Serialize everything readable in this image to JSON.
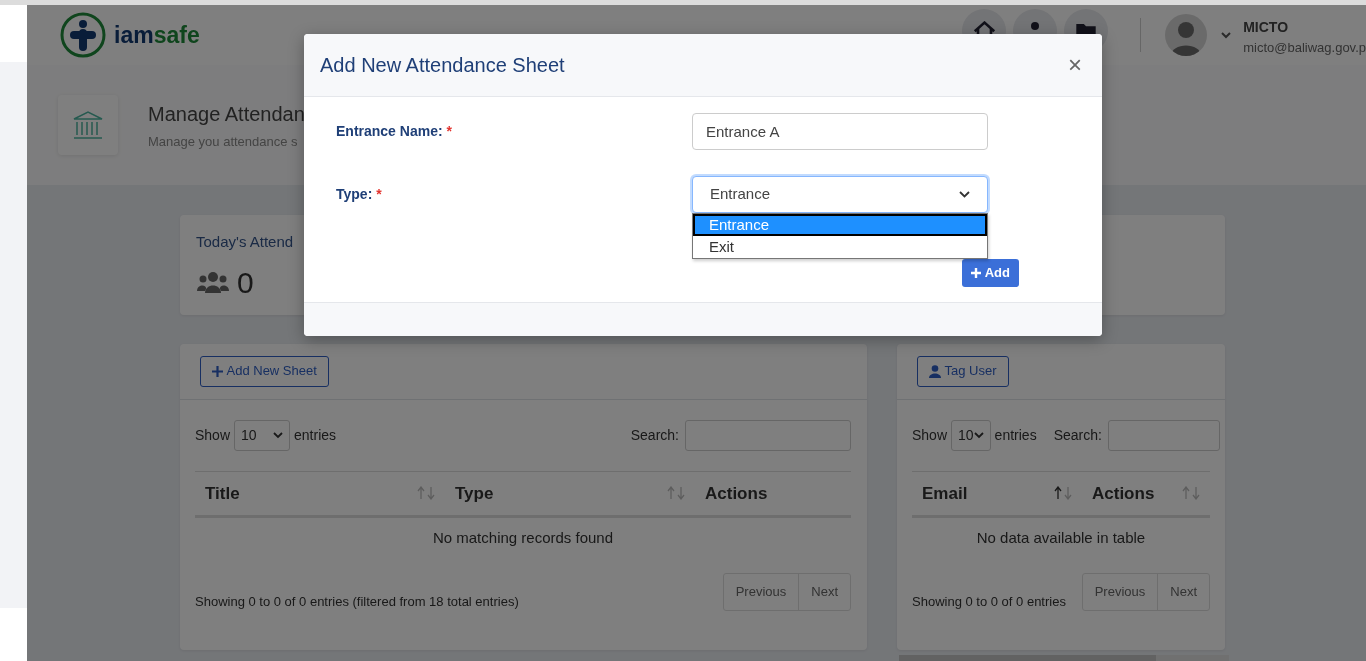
{
  "header": {
    "logo": "iam**safe**",
    "nav_icons": [
      {
        "kind": "home"
      },
      {
        "kind": "person"
      },
      {
        "kind": "folder"
      }
    ],
    "user": {
      "name": "MICTO",
      "email": "micto@baliwag.gov.p"
    }
  },
  "page_header": {
    "title": "Manage Attendan",
    "subtitle": "Manage you attendance s"
  },
  "stats": {
    "label": "Today's Attend",
    "value": "0"
  },
  "sheets_panel": {
    "button": "Add New Sheet",
    "show_label": "Show",
    "length": "10",
    "entries_label": "entries",
    "search_label": "Search:",
    "columns": [
      {
        "kind": "sortable",
        "label": "Title",
        "sorted": false
      },
      {
        "kind": "sortable",
        "label": "Type",
        "sorted": false
      },
      {
        "kind": "plain",
        "label": "Actions"
      }
    ],
    "empty": "No matching records found",
    "info": "Showing 0 to 0 of 0 entries (filtered from 18 total entries)",
    "pager": [
      "Previous",
      "Next"
    ]
  },
  "users_panel": {
    "button": "Tag User",
    "show_label": "Show",
    "length": "10",
    "entries_label": "entries",
    "search_label": "Search:",
    "columns": [
      {
        "kind": "sortable",
        "label": "Email",
        "sorted": true
      },
      {
        "kind": "sortable",
        "label": "Actions",
        "sorted": false
      }
    ],
    "empty": "No data available in table",
    "info": "Showing 0 to 0 of 0 entries",
    "pager": [
      "Previous",
      "Next"
    ]
  },
  "modal": {
    "title": "Add New Attendance Sheet",
    "close": "×",
    "fields": [
      {
        "kind": "text",
        "label": "Entrance Name:",
        "required_mark": "*",
        "value": "Entrance A"
      },
      {
        "kind": "select",
        "label": "Type:",
        "required_mark": "*",
        "value": "Entrance",
        "expanded": true,
        "options": [
          {
            "label": "Entrance",
            "selected": true
          },
          {
            "label": "Exit",
            "selected": false
          }
        ]
      }
    ],
    "submit": "Add"
  }
}
